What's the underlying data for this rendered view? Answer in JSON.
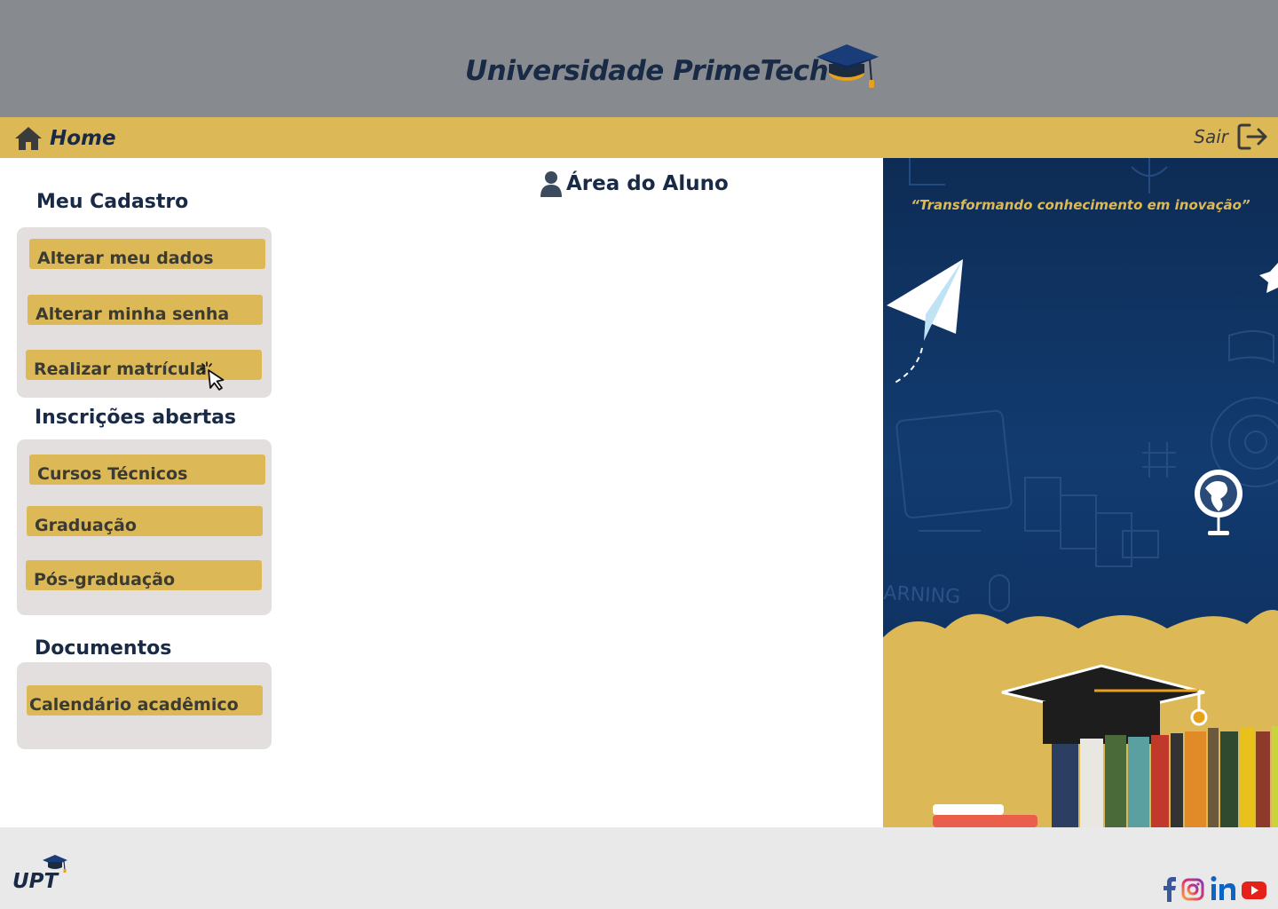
{
  "header": {
    "title": "Universidade PrimeTech"
  },
  "navbar": {
    "home_label": "Home",
    "logout_label": "Sair"
  },
  "main": {
    "area_title": "Área do Aluno",
    "sections": {
      "cadastro": {
        "title": "Meu Cadastro",
        "items": [
          "Alterar meu dados",
          "Alterar minha senha",
          "Realizar matrícula"
        ]
      },
      "inscricoes": {
        "title": "Inscrições abertas",
        "items": [
          "Cursos Técnicos",
          "Graduação",
          "Pós-graduação"
        ]
      },
      "documentos": {
        "title": "Documentos",
        "items": [
          "Calendário acadêmico"
        ]
      }
    }
  },
  "banner": {
    "quote": "“Transformando conhecimento em inovação”"
  },
  "footer": {
    "logo_text": "UPT",
    "social": [
      "facebook-icon",
      "instagram-icon",
      "linkedin-icon",
      "youtube-icon"
    ]
  },
  "colors": {
    "header_bg": "#878b90",
    "accent_gold": "#dcb956",
    "navy": "#182a45",
    "panel_bg": "#e4dfdf",
    "footer_bg": "#e9e9e9"
  }
}
